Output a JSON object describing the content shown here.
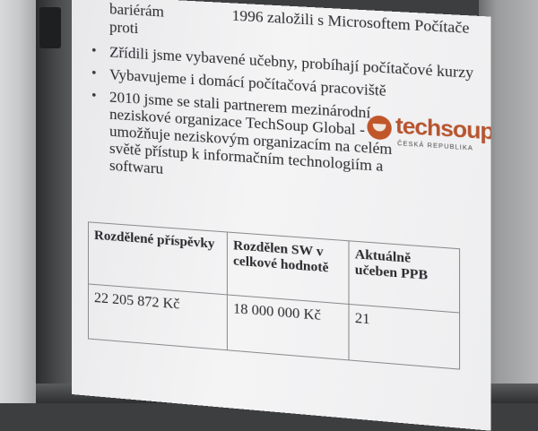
{
  "slide": {
    "top_line": "bariérám",
    "partial_header": "1996 založili s Microsoftem Počítače proti",
    "bullets": [
      "Zřídili jsme vybavené učebny, probíhají počítačové kurzy",
      "Vybavujeme i domácí počítačová pracoviště",
      "2010 jsme se stali partnerem mezinárodní neziskové organizace TechSoup Global - umožňuje neziskovým organizacím na celém světě přístup k informačním technologiím a softwaru"
    ],
    "logo": {
      "word": "techsoup",
      "sub": "ČESKÁ REPUBLIKA",
      "color": "#b7552f"
    }
  },
  "table": {
    "headers": [
      "Rozdělené příspěvky",
      "Rozdělen SW v celkové hodnotě",
      "Aktuálně učeben PPB"
    ],
    "rows": [
      [
        "22 205 872 Kč",
        "18 000 000 Kč",
        "21"
      ]
    ]
  }
}
